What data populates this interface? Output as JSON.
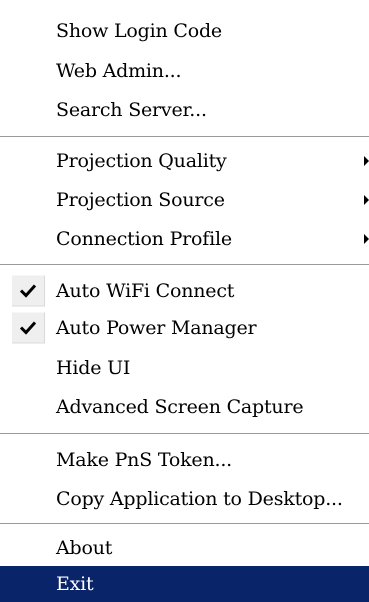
{
  "menu": {
    "items": [
      {
        "label": "Show Login Code"
      },
      {
        "label": "Web Admin..."
      },
      {
        "label": "Search Server..."
      },
      {
        "label": "Projection Quality",
        "submenu": true
      },
      {
        "label": "Projection Source",
        "submenu": true
      },
      {
        "label": "Connection Profile",
        "submenu": true
      },
      {
        "label": "Auto WiFi Connect",
        "checked": true
      },
      {
        "label": "Auto Power Manager",
        "checked": true
      },
      {
        "label": "Hide UI"
      },
      {
        "label": "Advanced Screen Capture"
      },
      {
        "label": "Make PnS Token..."
      },
      {
        "label": "Copy Application to Desktop..."
      },
      {
        "label": "About"
      },
      {
        "label": "Exit",
        "highlighted": true
      }
    ],
    "icons": {
      "check": "checkmark-icon",
      "submenu": "submenu-arrow-icon"
    },
    "colors": {
      "highlight_background": "#0a246a",
      "highlight_text": "#ffffff",
      "check_background": "#efefef"
    }
  }
}
